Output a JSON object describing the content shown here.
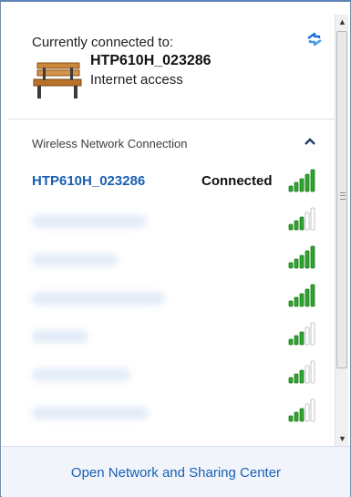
{
  "connected": {
    "heading": "Currently connected to:",
    "network_name": "HTP610H_023286",
    "access_status": "Internet access",
    "icon": "bench-network-icon",
    "refresh_icon": "refresh-arrows-icon"
  },
  "section": {
    "label": "Wireless Network Connection",
    "chevron": "chevron-up-icon"
  },
  "networks": [
    {
      "name": "HTP610H_023286",
      "status": "Connected",
      "signal_bars": 5,
      "blurred": false
    },
    {
      "name": "",
      "status": "",
      "signal_bars": 3,
      "blurred": true
    },
    {
      "name": "",
      "status": "",
      "signal_bars": 5,
      "blurred": true
    },
    {
      "name": "",
      "status": "",
      "signal_bars": 5,
      "blurred": true
    },
    {
      "name": "",
      "status": "",
      "signal_bars": 3,
      "blurred": true
    },
    {
      "name": "",
      "status": "",
      "signal_bars": 3,
      "blurred": true
    },
    {
      "name": "",
      "status": "",
      "signal_bars": 3,
      "blurred": true
    }
  ],
  "footer": {
    "link_label": "Open Network and Sharing Center"
  },
  "colors": {
    "link": "#1a5fb4",
    "signal_on": "#2fa52f",
    "signal_off": "#b5b5b5",
    "footer_bg": "#f1f5fb"
  }
}
